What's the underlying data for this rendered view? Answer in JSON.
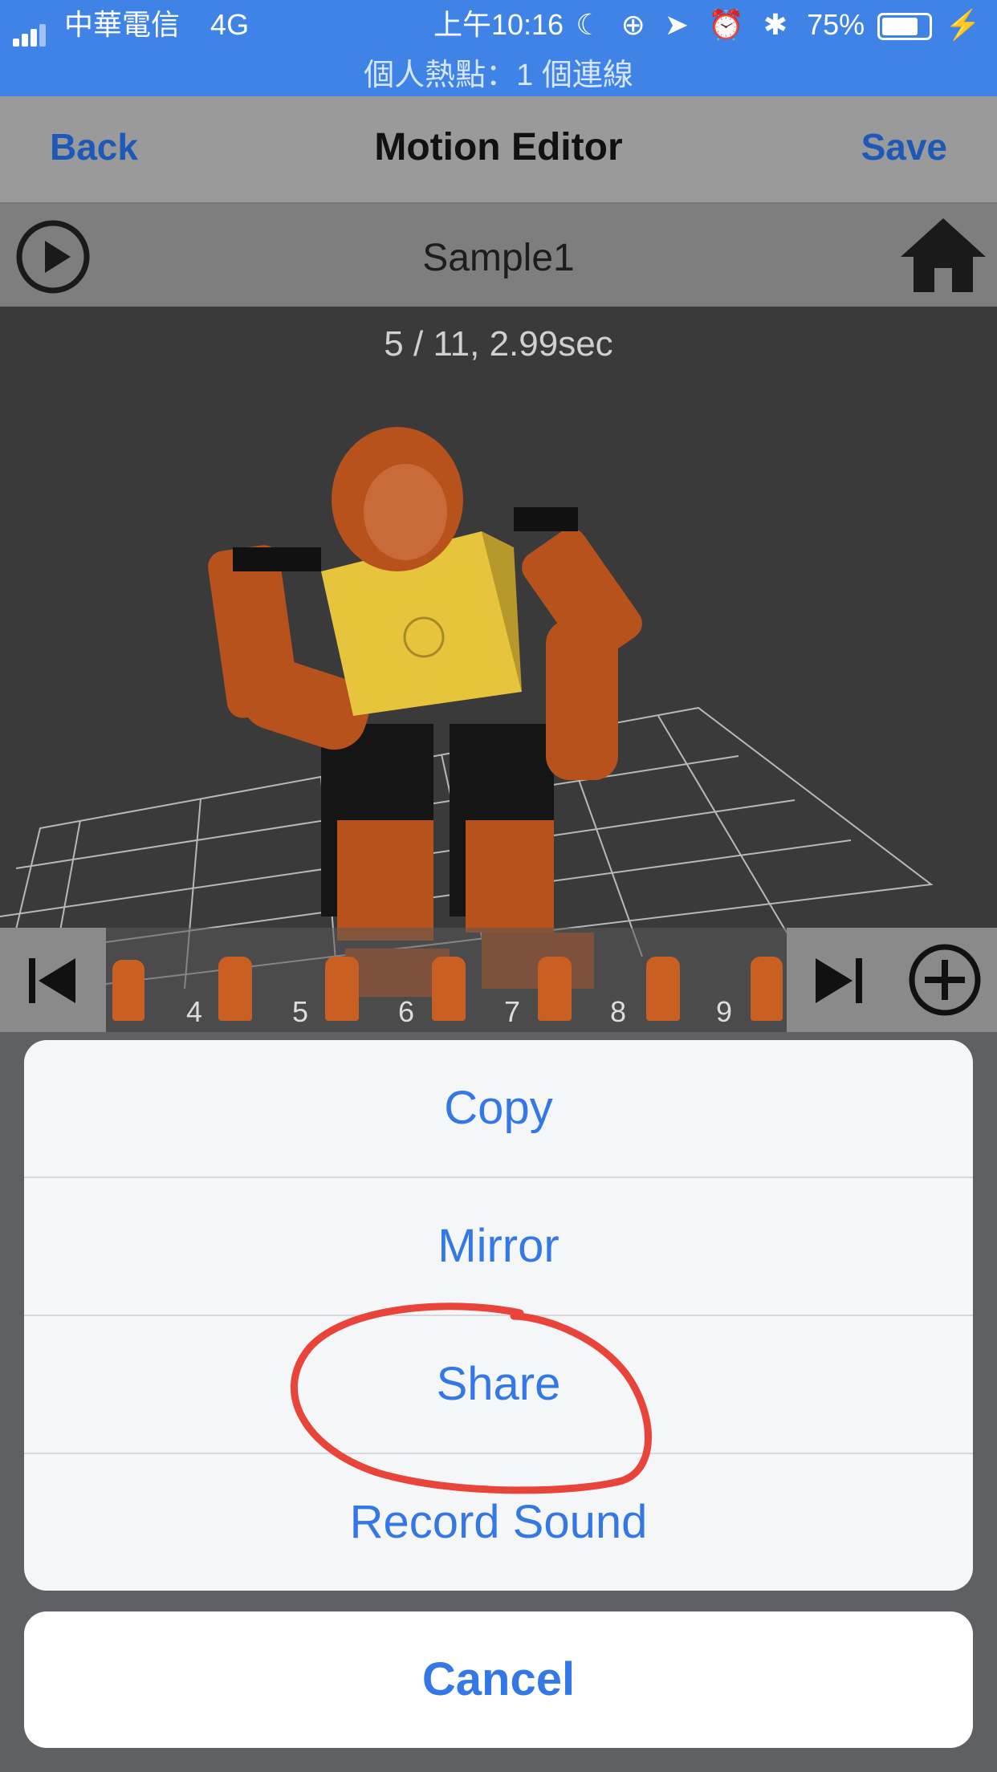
{
  "status_bar": {
    "carrier": "中華電信",
    "network": "4G",
    "time": "上午10:16",
    "battery": "75%",
    "hotspot": "個人熱點：1 個連線"
  },
  "nav": {
    "back_label": "Back",
    "title": "Motion Editor",
    "save_label": "Save"
  },
  "motion": {
    "name": "Sample1",
    "frame_info": "5 / 11, 2.99sec"
  },
  "timeline": {
    "frame_numbers": [
      "4",
      "5",
      "6",
      "7",
      "8",
      "9"
    ]
  },
  "action_sheet": {
    "options": [
      "Copy",
      "Mirror",
      "Share",
      "Record Sound"
    ],
    "cancel_label": "Cancel"
  },
  "colors": {
    "status_blue": "#3f83e6",
    "ios_blue": "#3478e8",
    "annotation_red": "#e8443a"
  }
}
